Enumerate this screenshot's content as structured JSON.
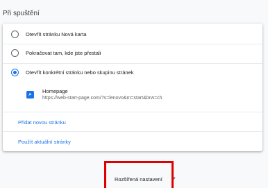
{
  "section": {
    "title": "Při spuštění"
  },
  "options": [
    {
      "label": "Otevřít stránku Nová karta",
      "selected": false
    },
    {
      "label": "Pokračovat tam, kde jste přestali",
      "selected": false
    },
    {
      "label": "Otevřít konkrétní stránku nebo skupinu stránek",
      "selected": true
    }
  ],
  "page_entry": {
    "title": "Homepage",
    "url": "https://web-start-page.com/?s=lenovo&m=start&brw=ch",
    "favicon": "search-icon"
  },
  "links": {
    "add_page": "Přidat novou stránku",
    "use_current": "Použít aktuální stránky"
  },
  "advanced": {
    "label": "Rozšířená nastavení",
    "icon": "chevron-down-icon"
  },
  "colors": {
    "accent": "#1a73e8",
    "highlight_box": "#e00000"
  }
}
